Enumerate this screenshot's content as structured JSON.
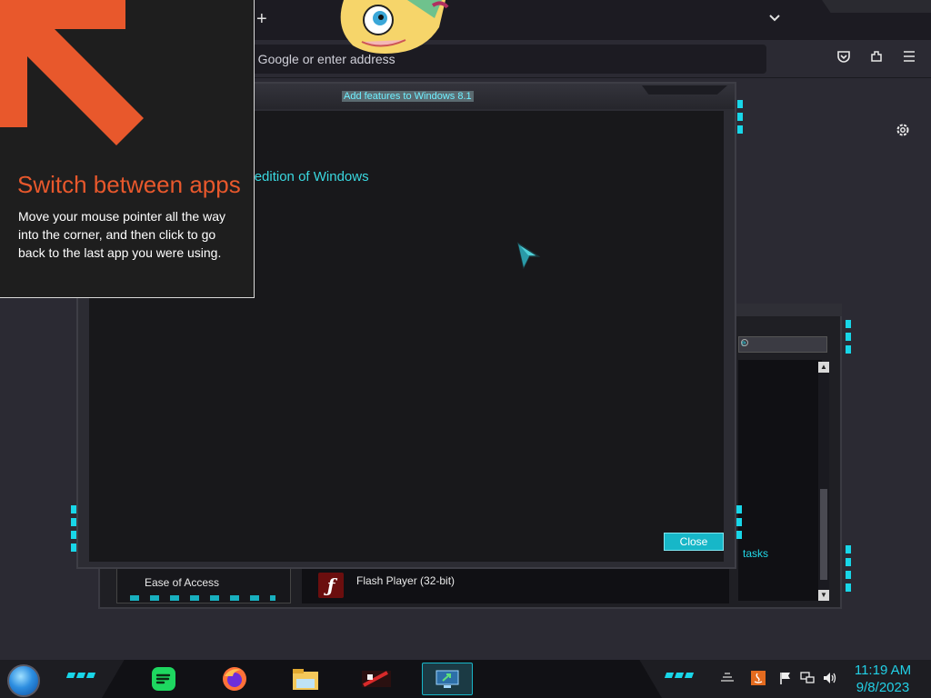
{
  "browser": {
    "new_tab_glyph": "+",
    "tab_list_glyph": "⌄",
    "address_placeholder": "n Google or enter address",
    "icons": [
      "pocket-icon",
      "extensions-icon",
      "menu-icon"
    ]
  },
  "dialog": {
    "title": "Add features to Windows 8.1",
    "heading": "tures to this edition of Windows",
    "close_label": "Close"
  },
  "tip": {
    "title": "Switch between apps",
    "body": "Move your mouse pointer all the way into the corner, and then click to go back to the last app you were using."
  },
  "programs": {
    "search_placeholder": "e",
    "tasks_link": "tasks",
    "category_label": "Ease of Access",
    "item_label": "Flash Player (32-bit)"
  },
  "taskbar": {
    "apps": [
      "spotify-icon",
      "firefox-icon",
      "file-explorer-icon",
      "media-app-icon",
      "remote-desktop-icon"
    ],
    "time": "11:19 AM",
    "date": "9/8/2023"
  },
  "colors": {
    "accent_cyan": "#18d6e8",
    "tip_orange": "#e8582c"
  }
}
